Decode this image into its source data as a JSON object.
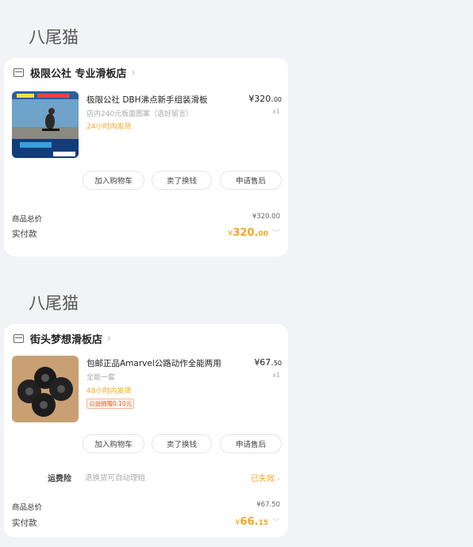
{
  "orders": [
    {
      "buyer": "八尾猫",
      "shop": "极限公社 专业滑板店",
      "product": {
        "title": "极限公社 DBH沸点新手组装滑板",
        "price_main": "¥320.",
        "price_dec": "00",
        "qty": "x1",
        "sku": "店内240元板面图案（选好留言）",
        "shipping": "24小时内发货",
        "thumb_icon": "skateboard-photo-icon"
      },
      "actions": [
        "加入购物车",
        "卖了换钱",
        "申请售后"
      ],
      "total_label": "商品总价",
      "total_value": "¥320.00",
      "paid_label": "实付款",
      "paid_currency": "¥",
      "paid_int": "320.",
      "paid_dec": "00"
    },
    {
      "buyer": "八尾猫",
      "shop": "街头梦想滑板店",
      "product": {
        "title": "包邮正品Amarvel公路动作全能两用",
        "price_main": "¥67.",
        "price_dec": "50",
        "qty": "x1",
        "sku": "全能一套",
        "shipping": "48小时内发货",
        "tag": "公益捐赠0.10元",
        "thumb_icon": "skateboard-wheels-photo-icon"
      },
      "actions": [
        "加入购物车",
        "卖了换钱",
        "申请售后"
      ],
      "insurance_label": "运费险",
      "insurance_desc": "退换货可自动理赔",
      "insurance_status": "已失效",
      "total_label": "商品总价",
      "total_value": "¥67.50",
      "paid_label": "实付款",
      "paid_currency": "¥",
      "paid_int": "66.",
      "paid_dec": "15"
    }
  ],
  "colors": {
    "accent": "#f5a623",
    "background": "#f2f3f7",
    "tag": "#e8591b"
  }
}
